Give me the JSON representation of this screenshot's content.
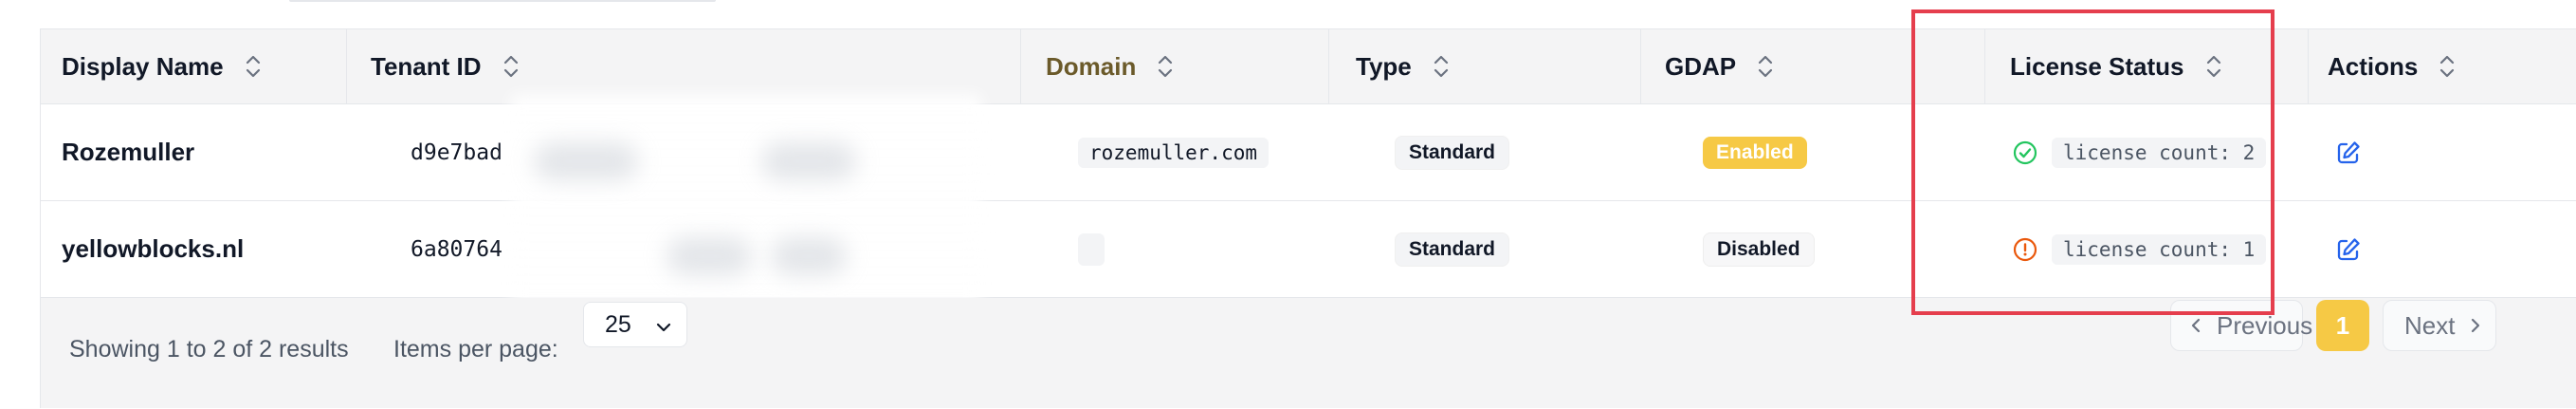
{
  "table": {
    "headers": [
      {
        "key": "display_name",
        "label": "Display Name"
      },
      {
        "key": "tenant_id",
        "label": "Tenant ID"
      },
      {
        "key": "domain",
        "label": "Domain"
      },
      {
        "key": "type",
        "label": "Type"
      },
      {
        "key": "gdap",
        "label": "GDAP"
      },
      {
        "key": "license_status",
        "label": "License Status"
      },
      {
        "key": "actions",
        "label": "Actions"
      }
    ],
    "rows": [
      {
        "display_name": "Rozemuller",
        "tenant_id": "d9e7bad",
        "domain": "rozemuller.com",
        "type": "Standard",
        "gdap": "Enabled",
        "license_icon": "check-circle-icon",
        "license_text": "license count: 2"
      },
      {
        "display_name": "yellowblocks.nl",
        "tenant_id": "6a80764",
        "domain": "",
        "type": "Standard",
        "gdap": "Disabled",
        "license_icon": "alert-circle-icon",
        "license_text": "license count: 1"
      }
    ]
  },
  "footer": {
    "results_text": "Showing 1 to 2 of 2 results",
    "items_per_page_label": "Items per page:",
    "items_per_page_value": "25",
    "previous_label": "Previous",
    "current_page": "1",
    "next_label": "Next"
  },
  "colors": {
    "accent_yellow": "#f6c945",
    "success_green": "#22c55e",
    "warning_orange": "#ea580c",
    "edit_blue": "#2563eb",
    "highlight_red": "#e53e4d"
  }
}
